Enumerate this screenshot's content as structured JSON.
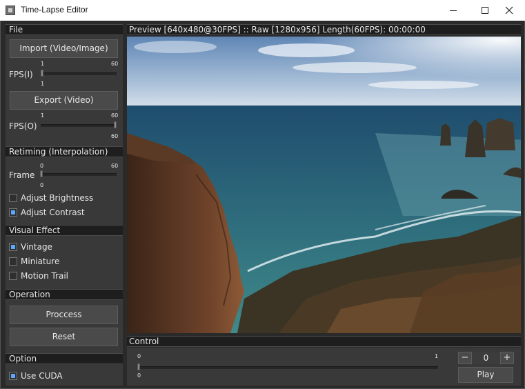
{
  "window": {
    "title": "Time-Lapse Editor"
  },
  "file": {
    "header": "File",
    "import_label": "Import (Video/Image)",
    "fps_in_label": "FPS(I)",
    "fps_in_min": "1",
    "fps_in_max": "60",
    "fps_in_value": "1",
    "export_label": "Export (Video)",
    "fps_out_label": "FPS(O)",
    "fps_out_min": "1",
    "fps_out_max": "60",
    "fps_out_value": "60"
  },
  "retiming": {
    "header": "Retiming (Interpolation)",
    "frame_label": "Frame",
    "frame_min": "0",
    "frame_max": "60",
    "frame_value": "0",
    "brightness_label": "Adjust Brightness",
    "brightness_checked": false,
    "contrast_label": "Adjust Contrast",
    "contrast_checked": true
  },
  "visual_effect": {
    "header": "Visual Effect",
    "vintage_label": "Vintage",
    "vintage_checked": true,
    "miniature_label": "Miniature",
    "miniature_checked": false,
    "motion_trail_label": "Motion Trail",
    "motion_trail_checked": false
  },
  "operation": {
    "header": "Operation",
    "process_label": "Proccess",
    "reset_label": "Reset"
  },
  "option": {
    "header": "Option",
    "cuda_label": "Use CUDA",
    "cuda_checked": true
  },
  "preview": {
    "header": "Preview [640x480@30FPS] :: Raw [1280x956] Length(60FPS): 00:00:00"
  },
  "control": {
    "header": "Control",
    "timeline_min": "0",
    "timeline_max": "1",
    "timeline_value": "0",
    "stepper_value": "0",
    "minus_label": "−",
    "plus_label": "+",
    "play_label": "Play"
  },
  "colors": {
    "panel": "#393939",
    "header": "#1e1e1e",
    "checkbox_accent": "#5aa8ff"
  }
}
